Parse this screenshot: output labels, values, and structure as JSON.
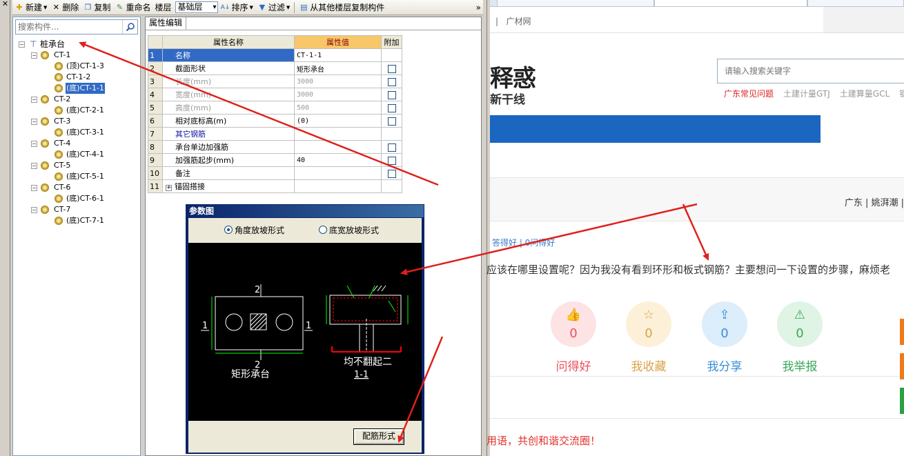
{
  "toolbar": {
    "new_label": "新建",
    "delete_label": "删除",
    "copy_label": "复制",
    "rename_label": "重命名",
    "floor_label": "楼层",
    "floor_value": "基础层",
    "sort_label": "排序",
    "filter_label": "过滤",
    "copy_from_label": "从其他楼层复制构件",
    "overflow": "»"
  },
  "tree_panel": {
    "search_placeholder": "搜索构件...",
    "root": "桩承台",
    "groups": [
      {
        "name": "CT-1",
        "children": [
          "(顶)CT-1-3",
          "CT-1-2",
          "(底)CT-1-1"
        ]
      },
      {
        "name": "CT-2",
        "children": [
          "(底)CT-2-1"
        ]
      },
      {
        "name": "CT-3",
        "children": [
          "(底)CT-3-1"
        ]
      },
      {
        "name": "CT-4",
        "children": [
          "(底)CT-4-1"
        ]
      },
      {
        "name": "CT-5",
        "children": [
          "(底)CT-5-1"
        ]
      },
      {
        "name": "CT-6",
        "children": [
          "(底)CT-6-1"
        ]
      },
      {
        "name": "CT-7",
        "children": [
          "(底)CT-7-1"
        ]
      }
    ],
    "selected": "(底)CT-1-1"
  },
  "prop_editor": {
    "tab": "属性编辑",
    "columns": [
      "属性名称",
      "属性值",
      "附加"
    ],
    "rows": [
      {
        "num": "1",
        "name": "名称",
        "value": "CT-1-1",
        "check": false,
        "style": "sel"
      },
      {
        "num": "2",
        "name": "截面形状",
        "value": "矩形承台",
        "check": true,
        "style": ""
      },
      {
        "num": "3",
        "name": "长度(mm)",
        "value": "3000",
        "check": true,
        "style": "gray"
      },
      {
        "num": "4",
        "name": "宽度(mm)",
        "value": "3000",
        "check": true,
        "style": "gray"
      },
      {
        "num": "5",
        "name": "高度(mm)",
        "value": "500",
        "check": true,
        "style": "gray"
      },
      {
        "num": "6",
        "name": "相对底标高(m)",
        "value": "(0)",
        "check": true,
        "style": ""
      },
      {
        "num": "7",
        "name": "其它钢筋",
        "value": "",
        "check": false,
        "style": "blue"
      },
      {
        "num": "8",
        "name": "承台单边加强筋",
        "value": "",
        "check": true,
        "style": ""
      },
      {
        "num": "9",
        "name": "加强筋起步(mm)",
        "value": "40",
        "check": true,
        "style": ""
      },
      {
        "num": "10",
        "name": "备注",
        "value": "",
        "check": true,
        "style": ""
      },
      {
        "num": "11",
        "name": "锚固搭接",
        "value": "",
        "check": false,
        "style": "expand"
      }
    ]
  },
  "param_dialog": {
    "title": "参数图",
    "radio_angle": "角度放坡形式",
    "radio_width": "底宽放坡形式",
    "plan_caption": "矩形承台",
    "section_caption": "均不翻起二",
    "section_id": "1-1",
    "mark_2": "2",
    "mark_1": "1",
    "button": "配筋形式"
  },
  "browser": {
    "site": "广材网",
    "hero_title": "释惑",
    "hero_sub": "新干线",
    "search_placeholder": "请输入搜索关键字",
    "hot_links": [
      "广东常见问题",
      "土建计量GTJ",
      "土建算量GCL",
      "钢"
    ],
    "user_line": "广东 | 姚湃潮 |",
    "stats": "答得好 | 0问得好",
    "question": "应该在哪里设置呢？因为我没有看到环形和板式钢筋？主要想问一下设置的步骤，麻烦老",
    "actions": [
      {
        "label": "问得好",
        "count": "0",
        "color": "#e8525d",
        "bg": "#fde3e4",
        "icon": "thumbs-up-icon"
      },
      {
        "label": "我收藏",
        "count": "0",
        "color": "#d9a34a",
        "bg": "#fdf0d8",
        "icon": "star-icon"
      },
      {
        "label": "我分享",
        "count": "0",
        "color": "#3a8ed8",
        "bg": "#dcedfb",
        "icon": "share-icon"
      },
      {
        "label": "我举报",
        "count": "0",
        "color": "#3aa85a",
        "bg": "#dff4e4",
        "icon": "warning-icon"
      }
    ],
    "footer": "用语，共创和谐交流圈！"
  },
  "colors": {
    "annotation_red": "#e0201b",
    "selection_blue": "#316ac5",
    "dialog_title": "#0a246a"
  }
}
